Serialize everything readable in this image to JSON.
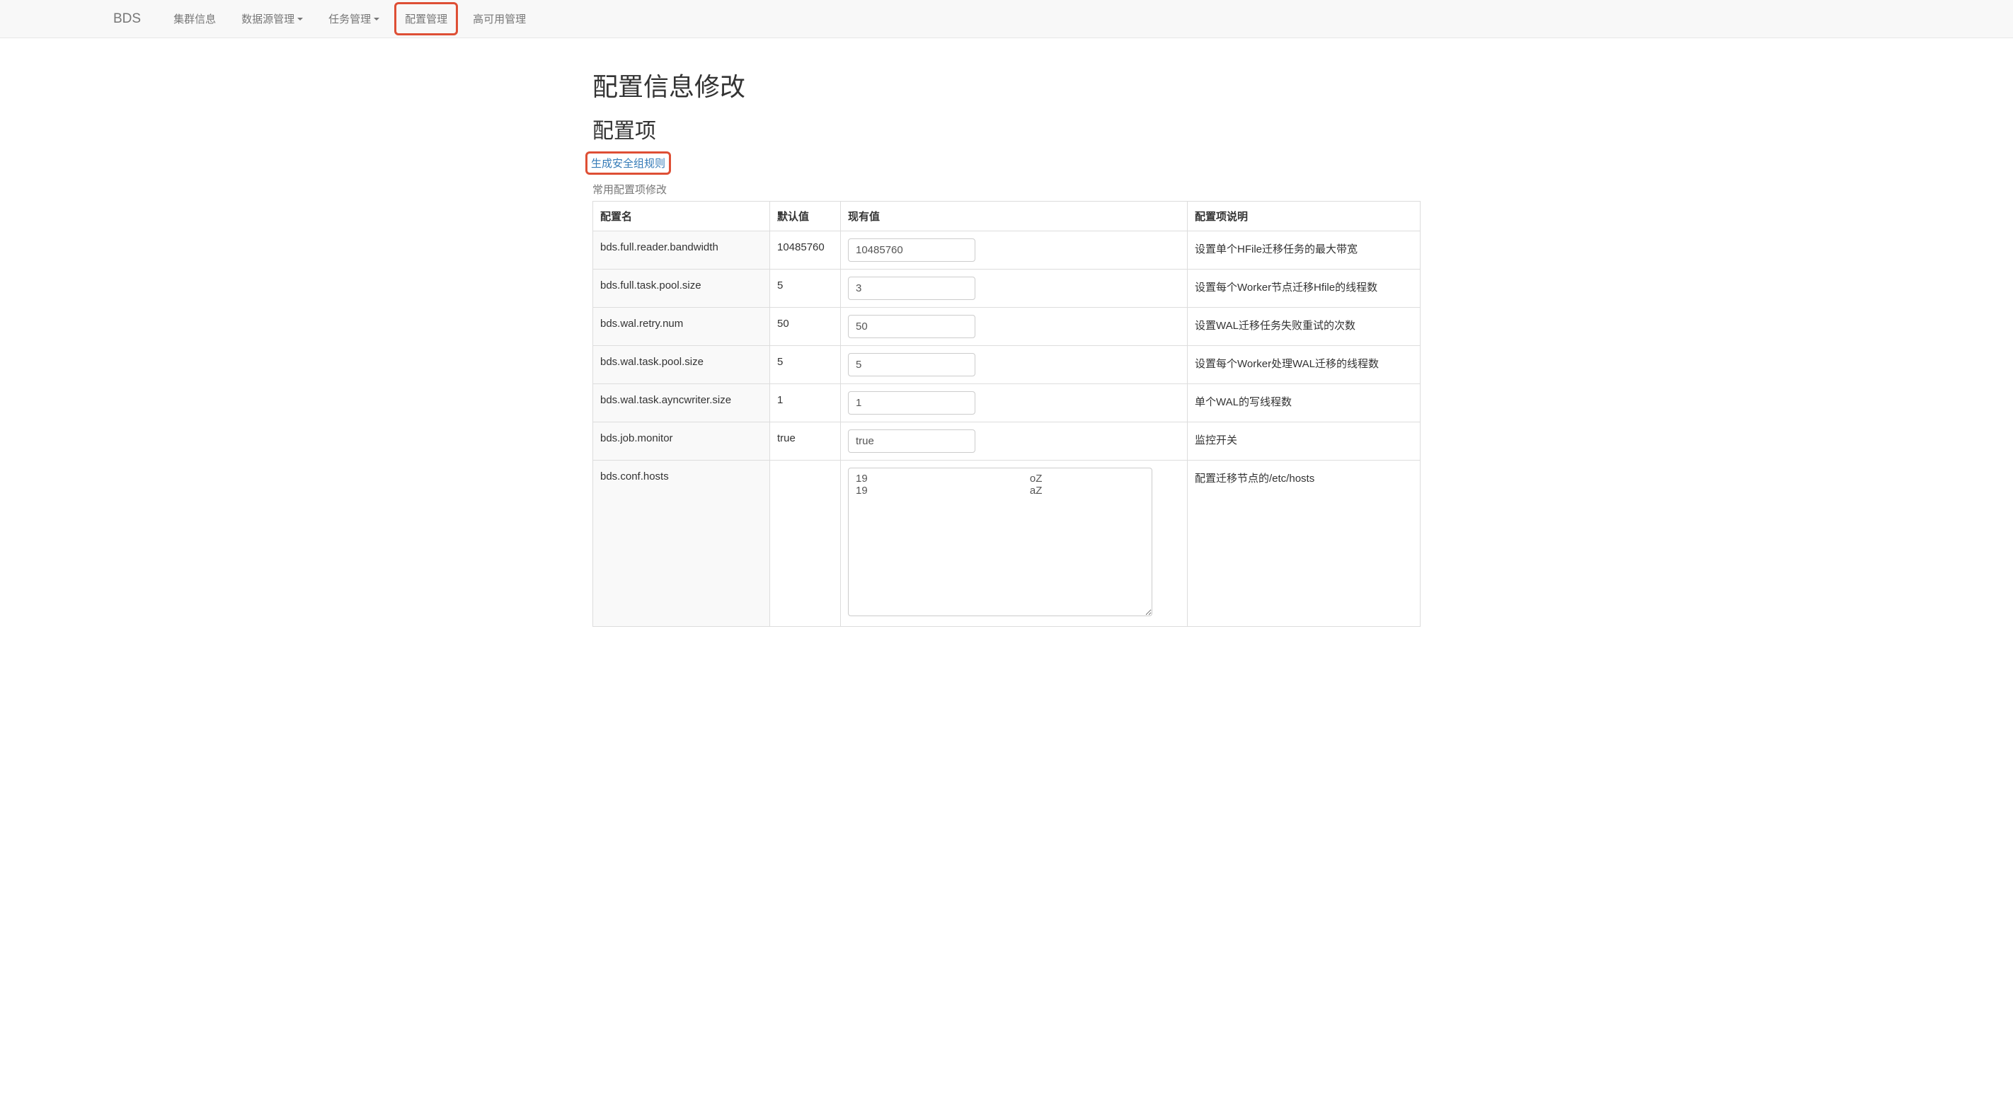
{
  "navbar": {
    "brand": "BDS",
    "items": [
      {
        "label": "集群信息",
        "dropdown": false,
        "highlighted": false
      },
      {
        "label": "数据源管理",
        "dropdown": true,
        "highlighted": false
      },
      {
        "label": "任务管理",
        "dropdown": true,
        "highlighted": false
      },
      {
        "label": "配置管理",
        "dropdown": false,
        "highlighted": true
      },
      {
        "label": "高可用管理",
        "dropdown": false,
        "highlighted": false
      }
    ]
  },
  "page": {
    "title": "配置信息修改",
    "subtitle": "配置项",
    "generate_link": "生成安全组规则",
    "subheading": "常用配置项修改"
  },
  "table": {
    "headers": {
      "name": "配置名",
      "default": "默认值",
      "current": "现有值",
      "desc": "配置项说明"
    },
    "rows": [
      {
        "name": "bds.full.reader.bandwidth",
        "default": "10485760",
        "current": "10485760",
        "desc": "设置单个HFile迁移任务的最大带宽",
        "type": "text"
      },
      {
        "name": "bds.full.task.pool.size",
        "default": "5",
        "current": "3",
        "desc": "设置每个Worker节点迁移Hfile的线程数",
        "type": "text"
      },
      {
        "name": "bds.wal.retry.num",
        "default": "50",
        "current": "50",
        "desc": "设置WAL迁移任务失败重试的次数",
        "type": "text"
      },
      {
        "name": "bds.wal.task.pool.size",
        "default": "5",
        "current": "5",
        "desc": "设置每个Worker处理WAL迁移的线程数",
        "type": "text"
      },
      {
        "name": "bds.wal.task.ayncwriter.size",
        "default": "1",
        "current": "1",
        "desc": "单个WAL的写线程数",
        "type": "text"
      },
      {
        "name": "bds.job.monitor",
        "default": "true",
        "current": "true",
        "desc": "监控开关",
        "type": "text"
      },
      {
        "name": "bds.conf.hosts",
        "default": "",
        "current": "19                                                       oZ\n19                                                       aZ",
        "desc": "配置迁移节点的/etc/hosts",
        "type": "textarea"
      }
    ]
  }
}
